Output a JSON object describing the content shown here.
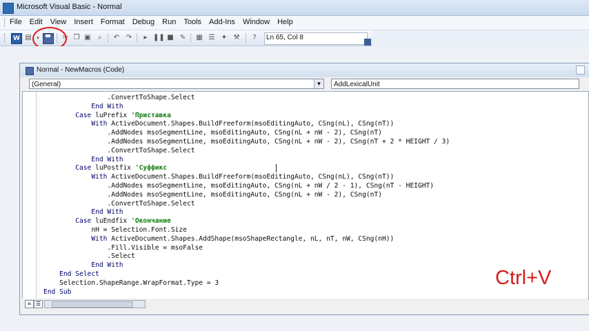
{
  "window": {
    "title": "Microsoft Visual Basic - Normal"
  },
  "menu": [
    "File",
    "Edit",
    "View",
    "Insert",
    "Format",
    "Debug",
    "Run",
    "Tools",
    "Add-Ins",
    "Window",
    "Help"
  ],
  "toolbar": {
    "position_label": "Ln 65, Col 8"
  },
  "code_window": {
    "title": "Normal - NewMacros (Code)",
    "object_dropdown": "(General)",
    "procedure_dropdown": "AddLexicalUnit"
  },
  "code_lines": [
    {
      "indent": "                .",
      "kw": "",
      "text": "ConvertToShape.Select",
      "comment": ""
    },
    {
      "indent": "            ",
      "kw": "End With",
      "text": "",
      "comment": ""
    },
    {
      "indent": "        ",
      "kw": "Case",
      "text": " luPrefix ",
      "comment": "'Приставка"
    },
    {
      "indent": "            ",
      "kw": "With",
      "text": " ActiveDocument.Shapes.BuildFreeform(msoEditingAuto, CSng(nL), CSng(nT))",
      "comment": ""
    },
    {
      "indent": "                ",
      "kw": "",
      "text": ".AddNodes msoSegmentLine, msoEditingAuto, CSng(nL + nW - 2), CSng(nT)",
      "comment": ""
    },
    {
      "indent": "                ",
      "kw": "",
      "text": ".AddNodes msoSegmentLine, msoEditingAuto, CSng(nL + nW - 2), CSng(nT + 2 * HEIGHT / 3)",
      "comment": ""
    },
    {
      "indent": "                ",
      "kw": "",
      "text": ".ConvertToShape.Select",
      "comment": ""
    },
    {
      "indent": "            ",
      "kw": "End With",
      "text": "",
      "comment": ""
    },
    {
      "indent": "        ",
      "kw": "Case",
      "text": " luPostfix ",
      "comment": "'Суффикс"
    },
    {
      "indent": "            ",
      "kw": "With",
      "text": " ActiveDocument.Shapes.BuildFreeform(msoEditingAuto, CSng(nL), CSng(nT))",
      "comment": ""
    },
    {
      "indent": "                ",
      "kw": "",
      "text": ".AddNodes msoSegmentLine, msoEditingAuto, CSng(nL + nW / 2 - 1), CSng(nT - HEIGHT)",
      "comment": ""
    },
    {
      "indent": "                ",
      "kw": "",
      "text": ".AddNodes msoSegmentLine, msoEditingAuto, CSng(nL + nW - 2), CSng(nT)",
      "comment": ""
    },
    {
      "indent": "                ",
      "kw": "",
      "text": ".ConvertToShape.Select",
      "comment": ""
    },
    {
      "indent": "            ",
      "kw": "End With",
      "text": "",
      "comment": ""
    },
    {
      "indent": "        ",
      "kw": "Case",
      "text": " luEndfix ",
      "comment": "'Окончание"
    },
    {
      "indent": "            ",
      "kw": "",
      "text": "nH = Selection.Font.Size",
      "comment": ""
    },
    {
      "indent": "            ",
      "kw": "With",
      "text": " ActiveDocument.Shapes.AddShape(msoShapeRectangle, nL, nT, nW, CSng(nH))",
      "comment": ""
    },
    {
      "indent": "                ",
      "kw": "",
      "text": ".Fill.Visible = msoFalse",
      "comment": ""
    },
    {
      "indent": "                ",
      "kw": "",
      "text": ".Select",
      "comment": ""
    },
    {
      "indent": "            ",
      "kw": "End With",
      "text": "",
      "comment": ""
    },
    {
      "indent": "    ",
      "kw": "End Select",
      "text": "",
      "comment": ""
    },
    {
      "indent": "    ",
      "kw": "",
      "text": "Selection.ShapeRange.WrapFormat.Type = 3",
      "comment": ""
    },
    {
      "indent": "",
      "kw": "End Sub",
      "text": "",
      "comment": ""
    }
  ],
  "overlay_text": "Ctrl+V",
  "colors": {
    "keyword": "#00006a",
    "comment": "#0a7a0a",
    "annotation": "#d61b1b"
  },
  "icons": [
    "word-icon",
    "new-module-icon",
    "save-icon",
    "cut-icon",
    "copy-icon",
    "paste-icon",
    "find-icon",
    "undo-icon",
    "redo-icon",
    "run-icon",
    "break-icon",
    "reset-icon",
    "design-mode-icon",
    "project-explorer-icon",
    "properties-icon",
    "object-browser-icon",
    "toolbox-icon",
    "help-icon"
  ]
}
